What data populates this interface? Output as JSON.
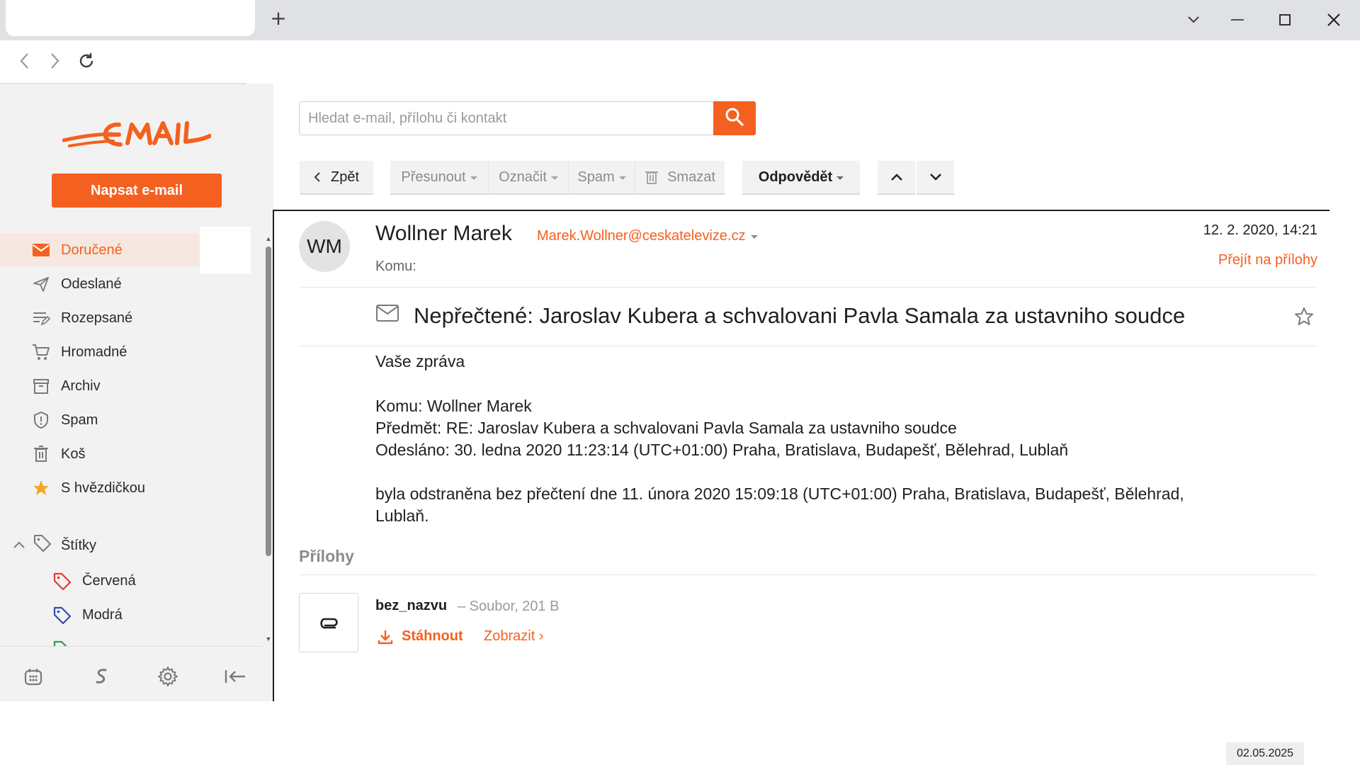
{
  "browser": {
    "new_tab_label": "+"
  },
  "app": {
    "logo_text": "EMAIL",
    "compose_label": "Napsat e-mail",
    "accent_color": "#f4601f"
  },
  "sidebar": {
    "folders": [
      {
        "label": "Doručené",
        "icon": "mail-icon",
        "active": true
      },
      {
        "label": "Odeslané",
        "icon": "send-icon"
      },
      {
        "label": "Rozepsané",
        "icon": "draft-icon"
      },
      {
        "label": "Hromadné",
        "icon": "cart-icon"
      },
      {
        "label": "Archiv",
        "icon": "archive-icon"
      },
      {
        "label": "Spam",
        "icon": "shield-icon"
      },
      {
        "label": "Koš",
        "icon": "trash-icon"
      },
      {
        "label": "S hvězdičkou",
        "icon": "star-icon"
      }
    ],
    "labels_header": "Štítky",
    "labels": [
      {
        "label": "Červená",
        "color": "#e53935"
      },
      {
        "label": "Modrá",
        "color": "#3949ab"
      }
    ],
    "bottom_icons": [
      "calendar-icon",
      "sync-icon",
      "settings-icon",
      "collapse-icon"
    ]
  },
  "search": {
    "placeholder": "Hledat e-mail, přílohu či kontakt"
  },
  "toolbar": {
    "back_label": "Zpět",
    "move_label": "Přesunout",
    "mark_label": "Označit",
    "spam_label": "Spam",
    "delete_label": "Smazat",
    "reply_label": "Odpovědět"
  },
  "message": {
    "avatar_initials": "WM",
    "sender_name": "Wollner Marek",
    "sender_email": "Marek.Wollner@ceskatelevize.cz",
    "recipient_label": "Komu:",
    "date": "12. 2. 2020, 14:21",
    "goto_attachments": "Přejít na přílohy",
    "subject": "Nepřečtené: Jaroslav Kubera a schvalovani Pavla Samala za ustavniho soudce",
    "body": [
      "Vaše zpráva",
      "Komu: Wollner Marek",
      "Předmět: RE: Jaroslav Kubera a schvalovani Pavla Samala za ustavniho soudce",
      "Odesláno: 30. ledna 2020 11:23:14 (UTC+01:00) Praha, Bratislava, Budapešť, Bělehrad, Lublaň",
      "byla odstraněna bez přečtení dne 11. února 2020 15:09:18 (UTC+01:00) Praha, Bratislava, Budapešť, Bělehrad,",
      "Lublaň."
    ],
    "attachments_heading": "Přílohy",
    "attachment": {
      "name": "bez_nazvu",
      "meta": "– Soubor, 201 B",
      "download_label": "Stáhnout",
      "view_label": "Zobrazit ›"
    }
  },
  "date_stamp": "02.05.2025"
}
